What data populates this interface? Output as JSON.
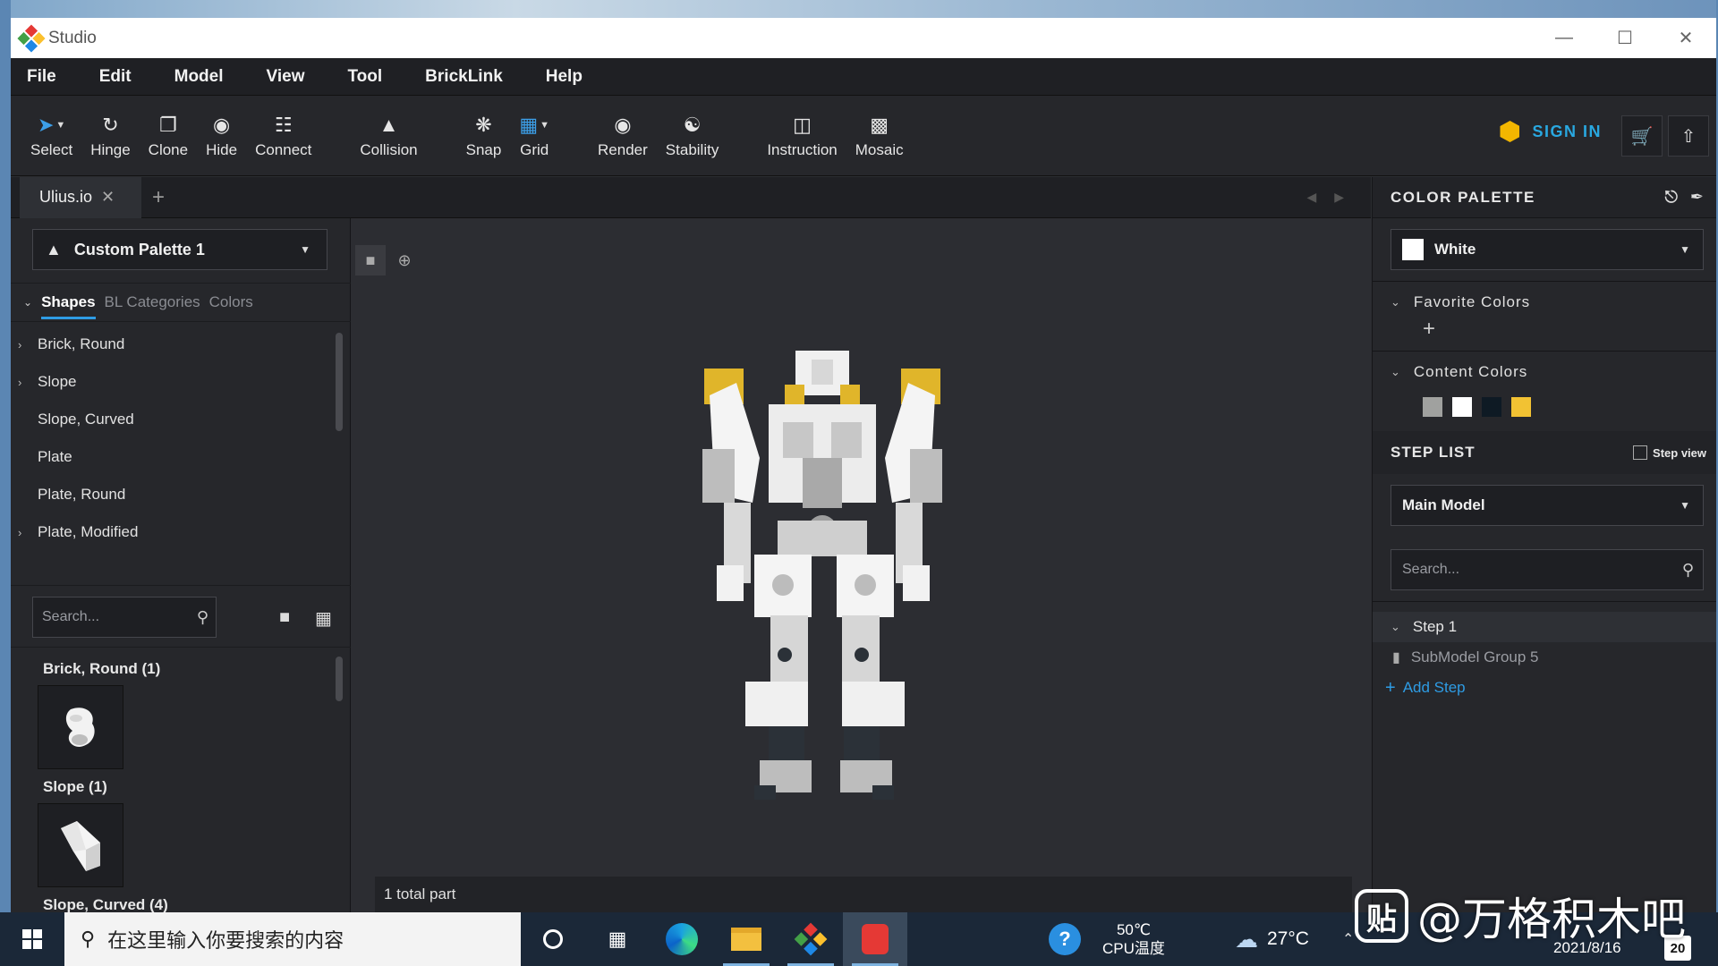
{
  "window": {
    "title": "Studio"
  },
  "menu": [
    "File",
    "Edit",
    "Model",
    "View",
    "Tool",
    "BrickLink",
    "Help"
  ],
  "toolbar": {
    "tools": [
      {
        "label": "Select",
        "icon": "cursor-icon"
      },
      {
        "label": "Hinge",
        "icon": "hinge-icon"
      },
      {
        "label": "Clone",
        "icon": "clone-icon"
      },
      {
        "label": "Hide",
        "icon": "eye-off-icon"
      },
      {
        "label": "Connect",
        "icon": "connect-icon"
      },
      {
        "label": "Collision",
        "icon": "warning-icon"
      },
      {
        "label": "Snap",
        "icon": "magnet-icon"
      },
      {
        "label": "Grid",
        "icon": "grid-icon"
      },
      {
        "label": "Render",
        "icon": "camera-icon"
      },
      {
        "label": "Stability",
        "icon": "stability-icon"
      },
      {
        "label": "Instruction",
        "icon": "book-icon"
      },
      {
        "label": "Mosaic",
        "icon": "mosaic-icon"
      }
    ],
    "sign_in": "SIGN IN"
  },
  "tabs": {
    "document": "Ulius.io",
    "add": "+"
  },
  "left_panel": {
    "palette": "Custom Palette 1",
    "tabs": [
      "Shapes",
      "BL Categories",
      "Colors"
    ],
    "categories": [
      {
        "name": "Brick, Round",
        "expandable": true
      },
      {
        "name": "Slope",
        "expandable": true
      },
      {
        "name": "Slope, Curved",
        "expandable": false
      },
      {
        "name": "Plate",
        "expandable": false
      },
      {
        "name": "Plate, Round",
        "expandable": false
      },
      {
        "name": "Plate, Modified",
        "expandable": true
      }
    ],
    "search_placeholder": "Search...",
    "groups": [
      "Brick, Round (1)",
      "Slope (1)",
      "Slope, Curved (4)"
    ]
  },
  "viewport": {
    "status": "1 total part"
  },
  "right_panel": {
    "color_palette": {
      "title": "COLOR PALETTE",
      "selected_color": "White",
      "favorite_colors": "Favorite Colors",
      "content_colors": "Content Colors",
      "swatches": [
        "#a0a19f",
        "#ffffff",
        "#0e1a24",
        "#f2c233"
      ]
    },
    "step_list": {
      "title": "STEP LIST",
      "step_view": "Step view",
      "model": "Main Model",
      "search_placeholder": "Search...",
      "step": "Step 1",
      "submodel": "SubModel Group 5",
      "add_step": "Add Step"
    }
  },
  "taskbar": {
    "search_placeholder": "在这里输入你要搜索的内容",
    "cpu_temp": "50℃",
    "cpu_label": "CPU温度",
    "weather": "27°C",
    "date": "2021/8/16",
    "notification_count": "20"
  },
  "watermark": {
    "badge": "贴",
    "text": "@万格积木吧"
  }
}
